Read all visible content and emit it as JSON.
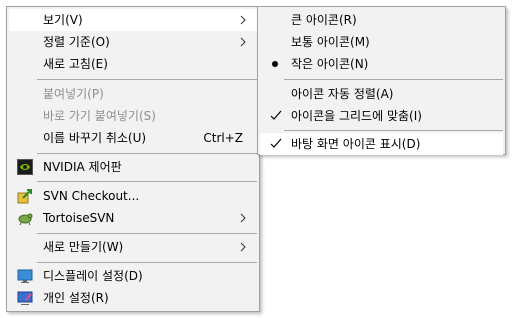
{
  "main_menu": {
    "view": {
      "label": "보기(V)",
      "icon": "chevron-right-icon"
    },
    "sort_by": {
      "label": "정렬 기준(O)",
      "icon": "chevron-right-icon"
    },
    "refresh": {
      "label": "새로 고침(E)"
    },
    "paste": {
      "label": "붙여넣기(P)",
      "state": "disabled"
    },
    "paste_shortcut": {
      "label": "바로 가기 붙여넣기(S)",
      "state": "disabled"
    },
    "undo_rename": {
      "label": "이름 바꾸기 취소(U)",
      "shortcut": "Ctrl+Z"
    },
    "nvidia": {
      "label": "NVIDIA 제어판",
      "icon": "nvidia-icon"
    },
    "svn_checkout": {
      "label": "SVN Checkout...",
      "icon": "svn-checkout-icon"
    },
    "tortoise_svn": {
      "label": "TortoiseSVN",
      "icon": "tortoisesvn-icon"
    },
    "new": {
      "label": "새로 만들기(W)",
      "icon": "chevron-right-icon"
    },
    "display_settings": {
      "label": "디스플레이 설정(D)",
      "icon": "display-icon"
    },
    "personalize": {
      "label": "개인 설정(R)",
      "icon": "personalize-icon"
    }
  },
  "view_submenu": {
    "large_icons": {
      "label": "큰 아이콘(R)"
    },
    "medium_icons": {
      "label": "보통 아이콘(M)"
    },
    "small_icons": {
      "label": "작은 아이콘(N)",
      "state": "selected"
    },
    "auto_arrange": {
      "label": "아이콘 자동 정렬(A)"
    },
    "align_to_grid": {
      "label": "아이콘을 그리드에 맞춤(I)",
      "state": "checked"
    },
    "show_desktop_icons": {
      "label": "바탕 화면 아이콘 표시(D)",
      "state": "checked"
    }
  },
  "colors": {
    "menu_background": "#f2f2f2",
    "highlight": "#ffffff",
    "disabled_text": "#8f8f8f",
    "separator": "#a8a8a8"
  }
}
